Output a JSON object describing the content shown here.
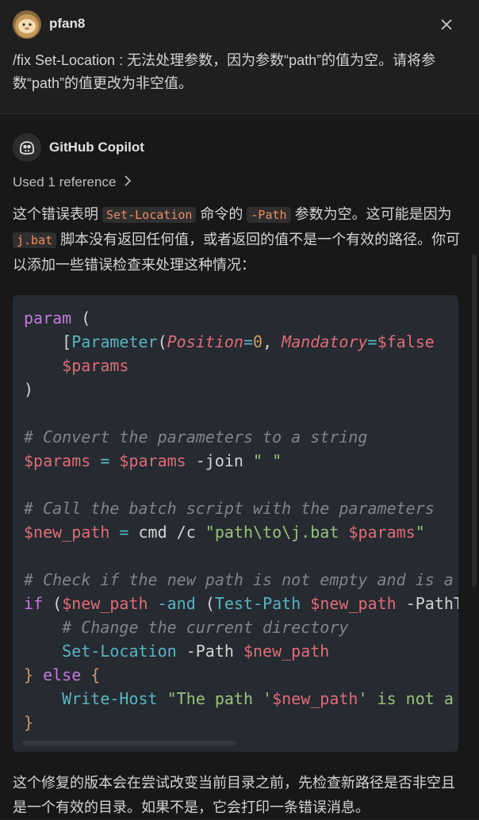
{
  "request": {
    "user": "pfan8",
    "text": "/fix Set-Location : 无法处理参数，因为参数“path”的值为空。请将参数“path”的值更改为非空值。"
  },
  "response": {
    "agent": "GitHub Copilot",
    "reference": "Used 1 reference",
    "intro": {
      "t1": "这个错误表明 ",
      "c1": "Set-Location",
      "t2": " 命令的 ",
      "c2": "-Path",
      "t3": " 参数为空。这可能是因为 ",
      "c3": "j.bat",
      "t4": " 脚本没有返回任何值，或者返回的值不是一个有效的路径。你可以添加一些错误检查来处理这种情况："
    },
    "code": {
      "l1": {
        "a": "param",
        "b": " ("
      },
      "l2": {
        "a": "    [",
        "b": "Parameter",
        "c": "(",
        "d": "Position",
        "e": "=",
        "f": "0",
        ", ": ", ",
        "g": "Mandatory",
        "h": "=",
        "i": "$false"
      },
      "l3": {
        "a": "    ",
        "b": "$params"
      },
      "l4": {
        "a": ")"
      },
      "l6": {
        "a": "# Convert the parameters to a string"
      },
      "l7": {
        "a": "$params",
        "b": " = ",
        "c": "$params",
        "d": " -join ",
        "e": "\" \""
      },
      "l9": {
        "a": "# Call the batch script with the parameters"
      },
      "l10": {
        "a": "$new_path",
        "b": " = ",
        "c": "cmd /c ",
        "d": "\"path\\to\\j.bat ",
        "e": "$params",
        "f": "\""
      },
      "l12": {
        "a": "# Check if the new path is not empty and is a valid directory"
      },
      "l13": {
        "a": "if",
        "b": " (",
        "c": "$new_path",
        "d": " -and ",
        "e": "(",
        "f": "Test-Path",
        "g": " ",
        "h": "$new_path",
        "i": " -PathType Container))"
      },
      "l14": {
        "a": "    # Change the current directory"
      },
      "l15": {
        "a": "    ",
        "b": "Set-Location",
        "c": " -Path ",
        "d": "$new_path"
      },
      "l16": {
        "a": "} ",
        "b": "else",
        "c": " {"
      },
      "l17": {
        "a": "    ",
        "b": "Write-Host",
        "c": " ",
        "d": "\"The path '",
        "e": "$new_path",
        "f": "' is not a valid directory\""
      },
      "l18": {
        "a": "}"
      }
    },
    "outro": "这个修复的版本会在尝试改变当前目录之前，先检查新路径是否非空且是一个有效的目录。如果不是，它会打印一条错误消息。"
  },
  "icons": {
    "close": "close-icon",
    "copilot": "copilot-icon",
    "chevron": "chevron-right-icon"
  }
}
